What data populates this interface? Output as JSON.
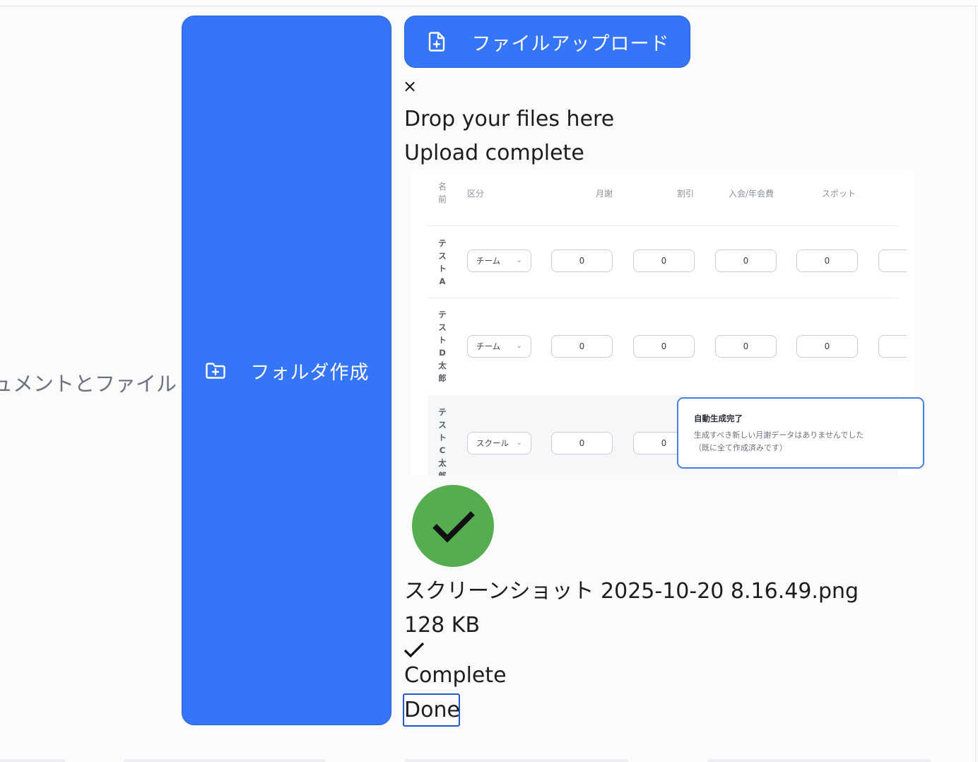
{
  "side_panel": {
    "label": "ドキュメントとファイル"
  },
  "folder_button": {
    "label": "フォルダ作成",
    "icon": "folder-plus-icon"
  },
  "upload_button": {
    "label": "ファイルアップロード",
    "icon": "file-plus-icon"
  },
  "dropzone": {
    "close_symbol": "×",
    "title": "Drop your files here",
    "status": "Upload complete"
  },
  "preview": {
    "name_header": "名前",
    "headers": [
      "区分",
      "月謝",
      "割引",
      "入会/年会費",
      "スポット"
    ],
    "rows": [
      {
        "name": "テストA",
        "category": "チーム",
        "values": [
          "0",
          "0",
          "0",
          "0"
        ]
      },
      {
        "name": "テストD太郎",
        "category": "チーム",
        "values": [
          "0",
          "0",
          "0",
          "0"
        ]
      },
      {
        "name": "テストC太郎",
        "category": "スクール",
        "values": [
          "0",
          "0"
        ]
      }
    ],
    "toast": {
      "title": "自動生成完了",
      "line1": "生成すべき新しい月謝データはありませんでした",
      "line2": "（既に全て作成済みです）"
    }
  },
  "file": {
    "name": "スクリーンショット 2025-10-20 8.16.49.png",
    "size": "128 KB",
    "complete_label": "Complete",
    "done_label": "Done"
  },
  "colors": {
    "primary": "#3575f7",
    "success": "#54ae4f",
    "focus_border": "#2258c9"
  }
}
